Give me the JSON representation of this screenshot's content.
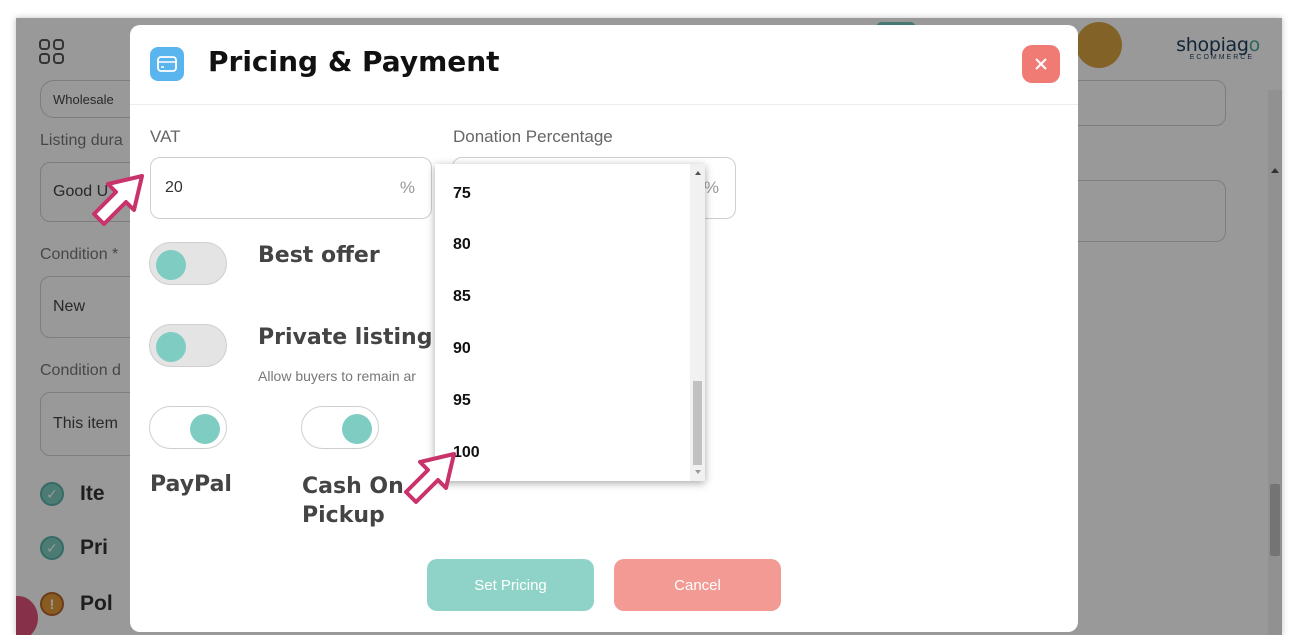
{
  "app": {
    "logo_main": "shopiag",
    "logo_mark": "o",
    "logo_sub": "ECOMMERCE"
  },
  "background_form": {
    "field_top_value": "Wholesale",
    "listing_duration_label": "Listing dura",
    "listing_duration_value": "Good U",
    "condition_label": "Condition *",
    "condition_value": "New",
    "condition_desc_label": "Condition d",
    "condition_desc_value": "This item"
  },
  "steps": [
    {
      "label": "Ite",
      "status": "ok",
      "glyph": "✓"
    },
    {
      "label": "Pri",
      "status": "ok",
      "glyph": "✓"
    },
    {
      "label": "Pol",
      "status": "warn",
      "glyph": "!"
    }
  ],
  "modal": {
    "title": "Pricing & Payment",
    "vat_label": "VAT",
    "vat_value": "20",
    "vat_suffix": "%",
    "donation_label": "Donation Percentage",
    "donation_suffix": "%",
    "best_offer_label": "Best offer",
    "private_listing_label": "Private listing",
    "private_listing_sub": "Allow buyers to remain ar",
    "paypal_label": "PayPal",
    "cash_label_line1": "Cash On",
    "cash_label_line2": "Pickup",
    "set_pricing_button": "Set Pricing",
    "cancel_button": "Cancel"
  },
  "dropdown": {
    "options": [
      "75",
      "80",
      "85",
      "90",
      "95",
      "100"
    ]
  },
  "colors": {
    "accent_teal": "#7fcdc2",
    "danger_coral": "#f07b74",
    "card_icon_blue": "#5ab5ee",
    "avatar_gold": "#d9a441",
    "cursor_pink": "#c8336b"
  }
}
